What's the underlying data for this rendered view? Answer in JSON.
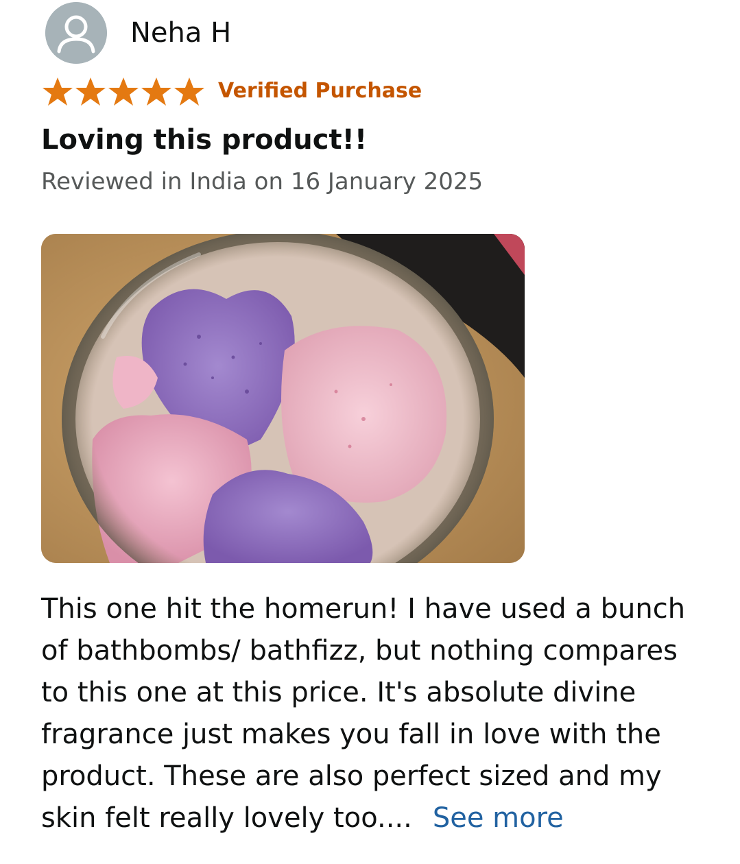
{
  "review": {
    "reviewer_name": "Neha H",
    "rating": 5,
    "rating_max": 5,
    "verified_label": "Verified Purchase",
    "title": "Loving this product!!",
    "date_text": "Reviewed in India on 16 January 2025",
    "photo_icon": "review-photo",
    "body_lines": [
      "This one hit the homerun! I have used a bunch",
      "of bathbombs/ bathfizz, but nothing compares",
      "to this one at this price. It's absolute divine",
      "fragrance just makes you fall in love with the",
      "product. These are also perfect sized and my",
      "skin felt really lovely too...."
    ],
    "see_more_label": "See more"
  },
  "colors": {
    "star": "#e47911",
    "verified": "#c45500",
    "link": "#2162a1",
    "secondary_text": "#565959",
    "avatar_bg": "#a7b3b8"
  }
}
